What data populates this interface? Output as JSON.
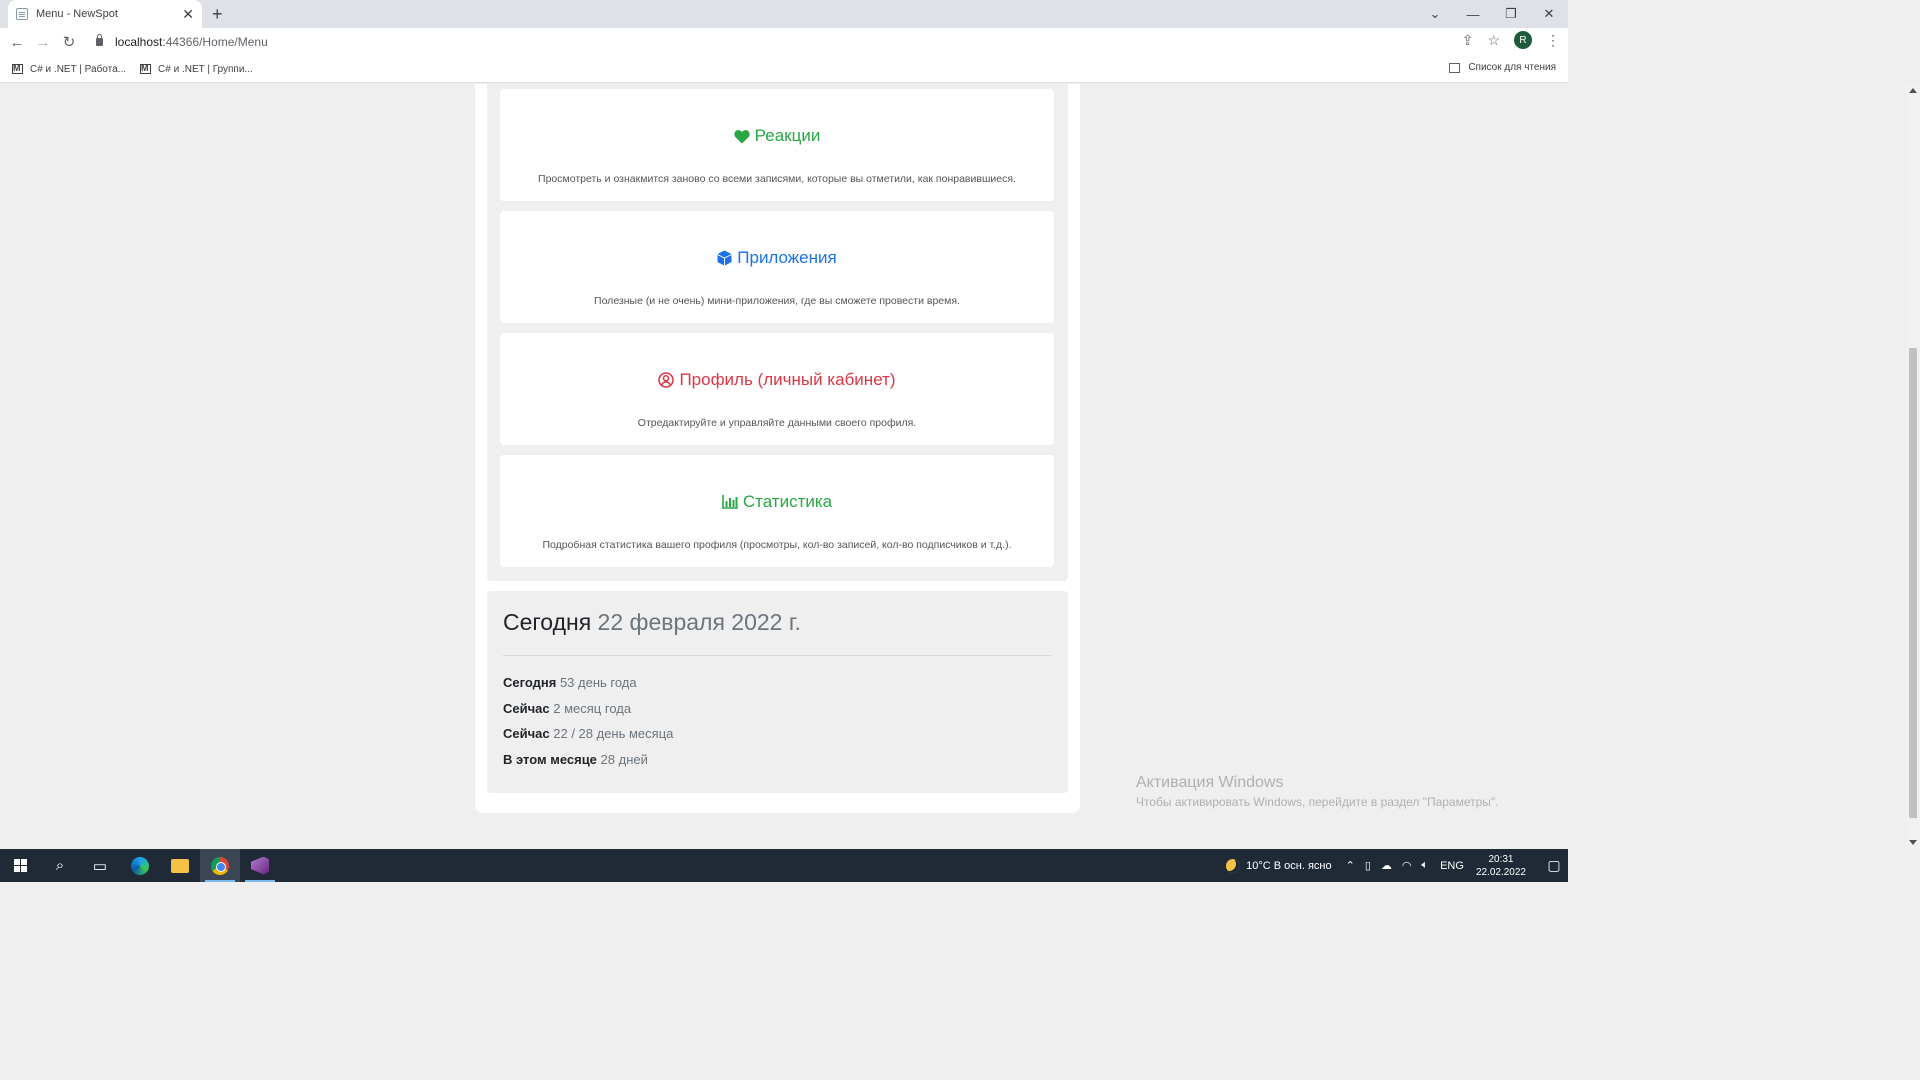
{
  "browser": {
    "tab_title": "Menu - NewSpot",
    "tab_close": "✕",
    "new_tab": "+",
    "url_host": "localhost",
    "url_path": ":44366/Home/Menu",
    "profile_initial": "R",
    "window_controls": {
      "collapse": "⌄",
      "minimize": "—",
      "restore": "❐",
      "close": "✕"
    },
    "bookmarks": [
      {
        "label": "C# и .NET | Работа..."
      },
      {
        "label": "C# и .NET | Группи..."
      }
    ],
    "reading_list": "Список для чтения"
  },
  "menu": {
    "cards": [
      {
        "icon": "heart-icon",
        "title": "Реакции",
        "desc": "Просмотреть и ознакмится заново со всеми записями, которые вы отметили, как понравившиеся.",
        "color": "#28a745"
      },
      {
        "icon": "box-icon",
        "title": "Приложения",
        "desc": "Полезные (и не очень) мини-приложения, где вы сможете провести время.",
        "color": "#1a73e8"
      },
      {
        "icon": "user-circle-icon",
        "title": "Профиль (личный кабинет)",
        "desc": "Отредактируйте и управляйте данными своего профиля.",
        "color": "#dc3545"
      },
      {
        "icon": "bar-chart-icon",
        "title": "Статистика",
        "desc": "Подробная статистика вашего профиля (просмотры, кол-во записей, кол-во подписчиков и т.д.).",
        "color": "#28a745"
      }
    ]
  },
  "today": {
    "title_label": "Сегодня",
    "title_date": "22 февраля 2022 г.",
    "rows": [
      {
        "label": "Сегодня",
        "value": "53 день года"
      },
      {
        "label": "Сейчас",
        "value": "2 месяц года"
      },
      {
        "label": "Сейчас",
        "value": "22 / 28 день месяца"
      },
      {
        "label": "В этом месяце",
        "value": "28 дней"
      }
    ]
  },
  "watermark": {
    "title": "Активация Windows",
    "subtitle": "Чтобы активировать Windows, перейдите в раздел \"Параметры\"."
  },
  "taskbar": {
    "weather": "10°C  В осн. ясно",
    "lang": "ENG",
    "time": "20:31",
    "date": "22.02.2022"
  }
}
